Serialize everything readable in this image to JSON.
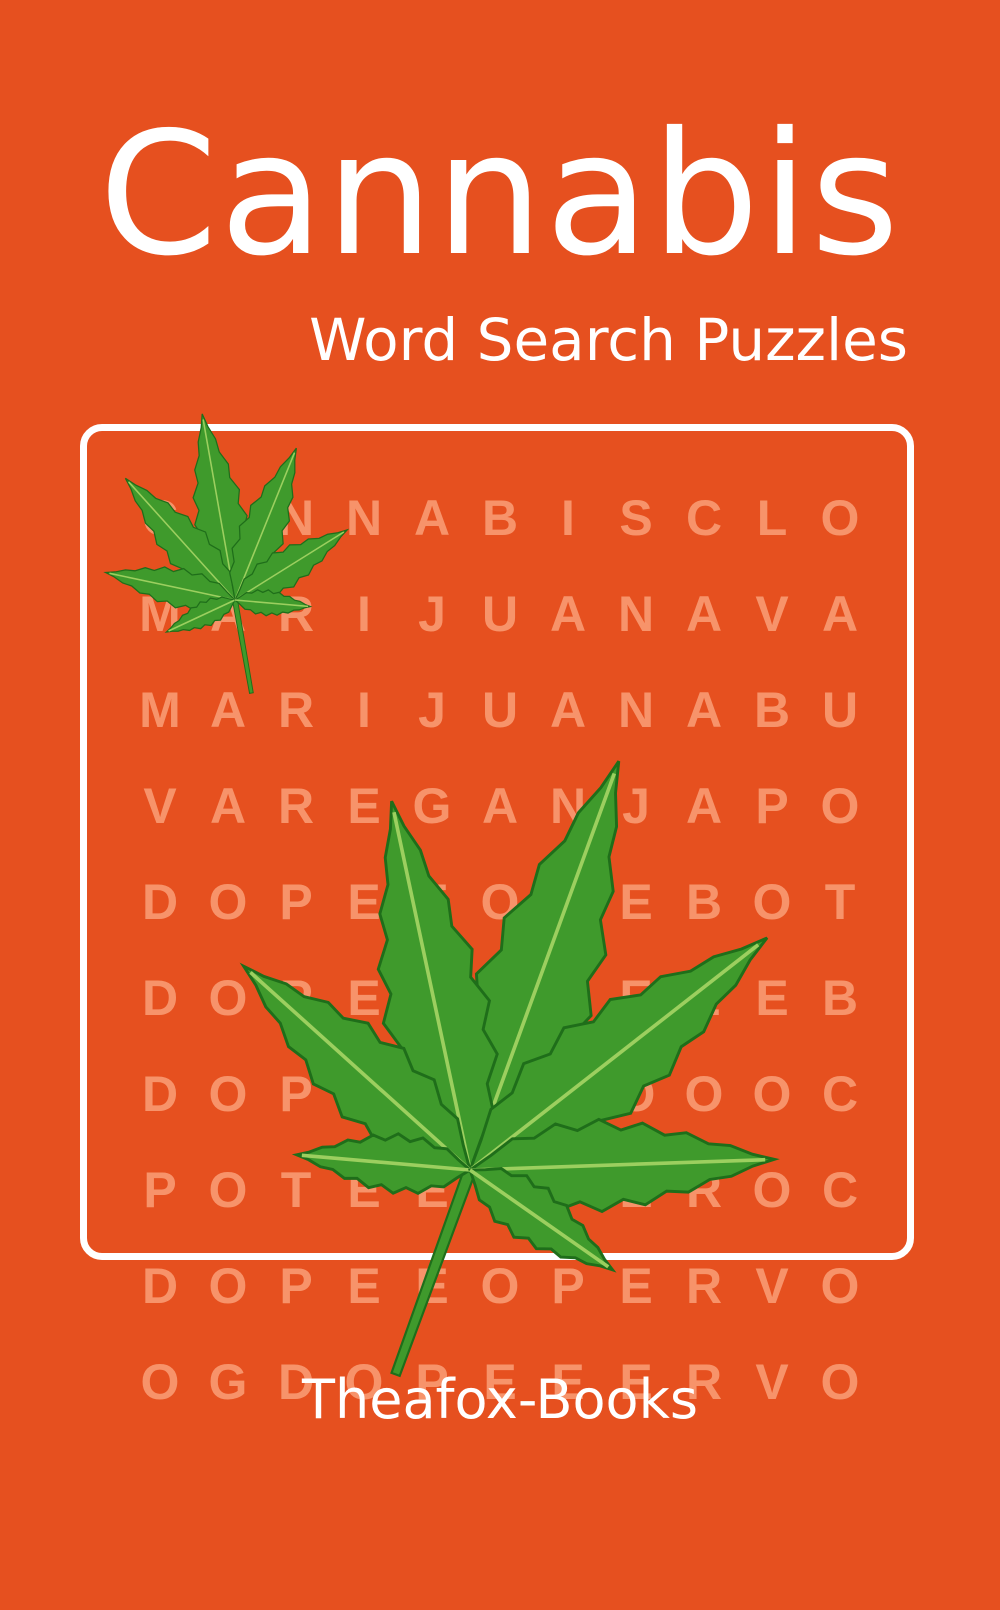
{
  "cover": {
    "title": "Cannabis",
    "subtitle": "Word Search Puzzles",
    "publisher": "Theafox-Books"
  },
  "colors": {
    "background": "#e6501f",
    "text": "#ffffff",
    "grid_letters": "#f7936a",
    "leaf_green": "#3f9a2c",
    "leaf_dark": "#1f6e1a",
    "leaf_vein": "#9ccf5f"
  },
  "word_grid": {
    "rows": [
      [
        "C",
        "A",
        "N",
        "N",
        "A",
        "B",
        "I",
        "S",
        "C",
        "L",
        "O"
      ],
      [
        "M",
        "A",
        "R",
        "I",
        "J",
        "U",
        "A",
        "N",
        "A",
        "V",
        "A"
      ],
      [
        "M",
        "A",
        "R",
        "I",
        "J",
        "U",
        "A",
        "N",
        "A",
        "B",
        "U"
      ],
      [
        "V",
        "A",
        "R",
        "E",
        "G",
        "A",
        "N",
        "J",
        "A",
        "P",
        "O"
      ],
      [
        "D",
        "O",
        "P",
        "E",
        "E",
        "O",
        "P",
        "E",
        "B",
        "O",
        "T"
      ],
      [
        "D",
        "O",
        "P",
        "E",
        "E",
        "O",
        "P",
        "E",
        "E",
        "E",
        "B"
      ],
      [
        "D",
        "O",
        "P",
        "E",
        "E",
        "O",
        "P",
        "O",
        "O",
        "O",
        "C"
      ],
      [
        "P",
        "O",
        "T",
        "E",
        "E",
        "O",
        "P",
        "E",
        "R",
        "O",
        "C"
      ],
      [
        "D",
        "O",
        "P",
        "E",
        "E",
        "O",
        "P",
        "E",
        "R",
        "V",
        "O"
      ],
      [
        "O",
        "G",
        "D",
        "O",
        "P",
        "E",
        "E",
        "E",
        "R",
        "V",
        "O"
      ]
    ]
  },
  "icons": [
    "cannabis-leaf-small-icon",
    "cannabis-leaf-large-icon"
  ]
}
